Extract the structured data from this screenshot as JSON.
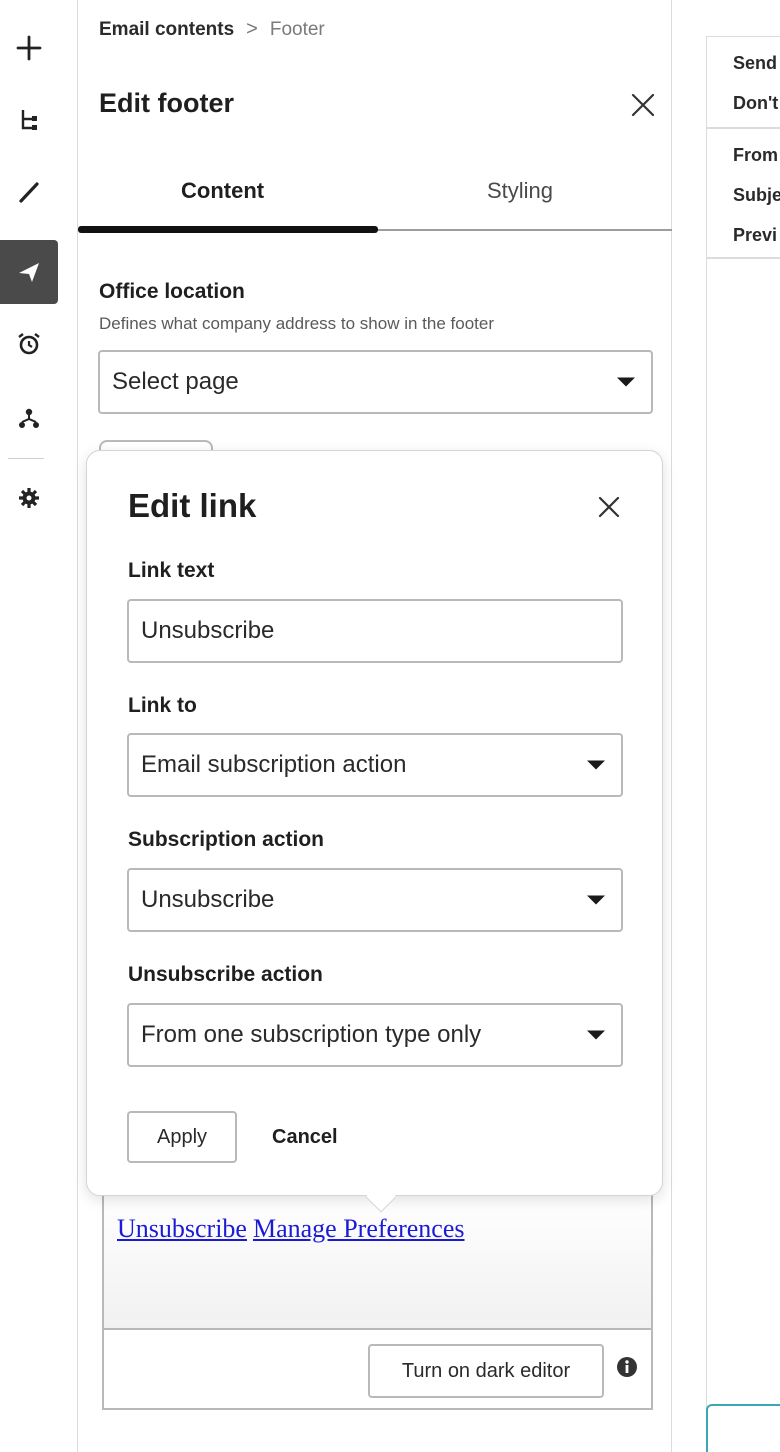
{
  "breadcrumb": {
    "root": "Email contents",
    "separator": ">",
    "current": "Footer"
  },
  "panel": {
    "title": "Edit footer"
  },
  "tabs": [
    {
      "label": "Content",
      "active": true
    },
    {
      "label": "Styling",
      "active": false
    }
  ],
  "office_location": {
    "label": "Office location",
    "help": "Defines what company address to show in the footer",
    "value": "Select page"
  },
  "edit_link": {
    "title": "Edit link",
    "link_text_label": "Link text",
    "link_text_value": "Unsubscribe",
    "link_to_label": "Link to",
    "link_to_value": "Email subscription action",
    "subscription_action_label": "Subscription action",
    "subscription_action_value": "Unsubscribe",
    "unsubscribe_action_label": "Unsubscribe action",
    "unsubscribe_action_value": "From one subscription type only",
    "apply_label": "Apply",
    "cancel_label": "Cancel"
  },
  "editor": {
    "links": [
      "Unsubscribe",
      "Manage Preferences"
    ],
    "dark_editor_label": "Turn on dark editor"
  },
  "preview": {
    "lines_top": [
      "Send",
      "Don't"
    ],
    "lines_bottom": [
      "From",
      "Subje",
      "Previ"
    ]
  },
  "colors": {
    "link": "#1b1bd6",
    "active_rail": "#4a4a4a",
    "focus_border": "#3aa7b5"
  },
  "icons": {
    "rail": [
      "plus-icon",
      "tree-icon",
      "pen-icon",
      "send-icon",
      "alarm-icon",
      "network-icon",
      "gear-icon"
    ],
    "close": "close-icon",
    "info": "info-icon"
  }
}
